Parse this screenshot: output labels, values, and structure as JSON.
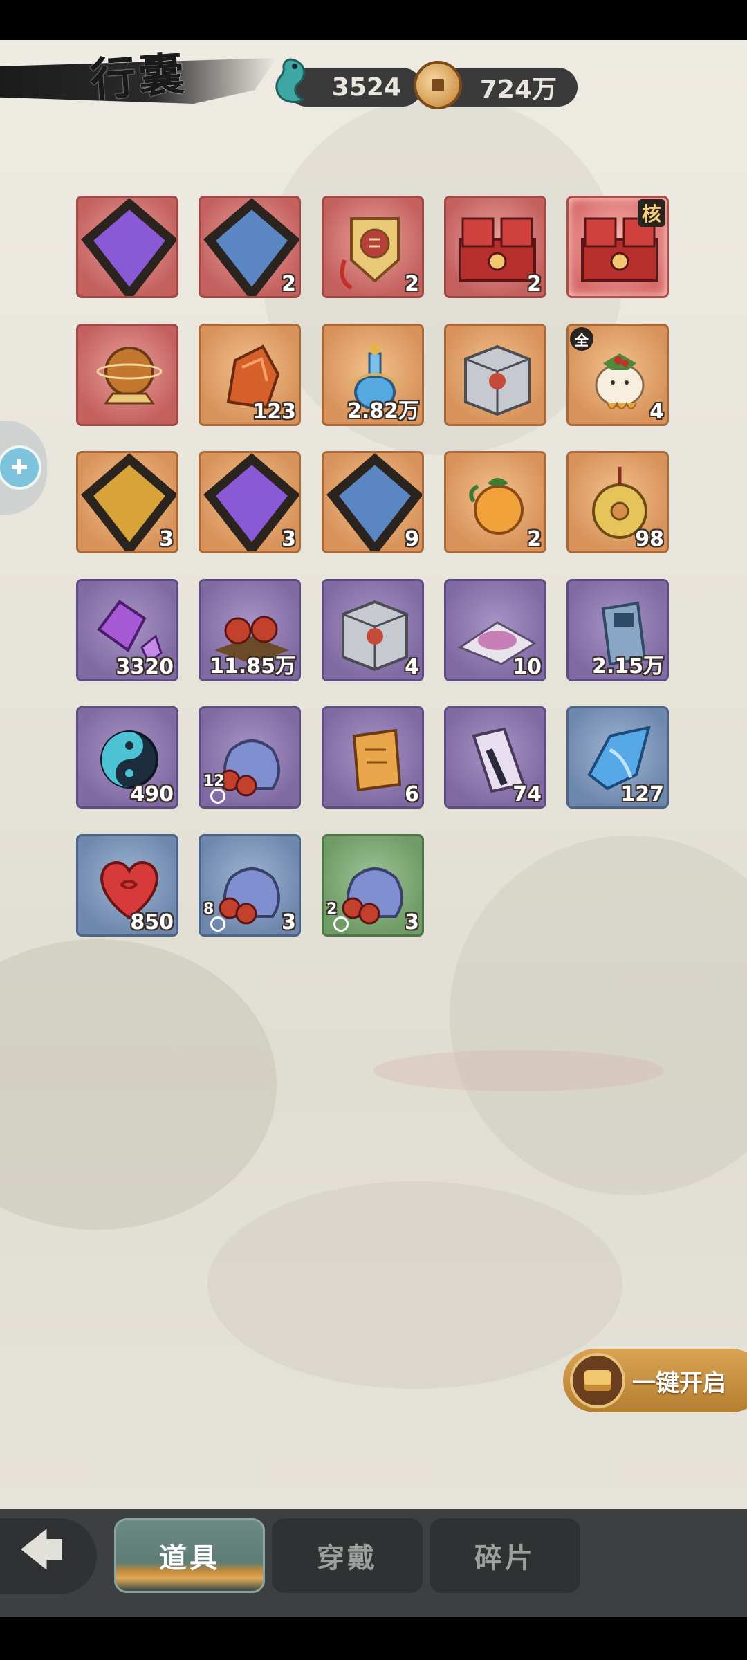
{
  "header": {
    "title": "行囊",
    "jade_count": "3524",
    "coin_count": "724万"
  },
  "items": [
    {
      "row": 0,
      "col": 0,
      "color": "red",
      "icon": "ginseng-doll-icon",
      "badge": "purple-gem",
      "count": ""
    },
    {
      "row": 0,
      "col": 1,
      "color": "red",
      "icon": "ginseng-doll-icon",
      "badge": "blue-gem",
      "count": "2"
    },
    {
      "row": 0,
      "col": 2,
      "color": "red",
      "icon": "token-plaque-icon",
      "badge": "",
      "count": "2"
    },
    {
      "row": 0,
      "col": 3,
      "color": "red",
      "icon": "treasure-chest-icon",
      "badge": "",
      "count": "2"
    },
    {
      "row": 0,
      "col": 4,
      "color": "red-hi",
      "icon": "treasure-chest-icon",
      "badge": "核",
      "count": ""
    },
    {
      "row": 1,
      "col": 0,
      "color": "red",
      "icon": "orb-on-stand-icon",
      "badge": "",
      "count": ""
    },
    {
      "row": 1,
      "col": 1,
      "color": "orange",
      "icon": "ore-crystal-icon",
      "badge": "",
      "count": "123"
    },
    {
      "row": 1,
      "col": 2,
      "color": "orange",
      "icon": "blue-flask-icon",
      "badge": "",
      "count": "2.82万"
    },
    {
      "row": 1,
      "col": 3,
      "color": "orange",
      "icon": "silver-box-icon",
      "badge": "",
      "count": ""
    },
    {
      "row": 1,
      "col": 4,
      "color": "orange",
      "icon": "ginseng-doll-icon",
      "badge": "全",
      "count": "4"
    },
    {
      "row": 2,
      "col": 0,
      "color": "orange",
      "icon": "ginseng-doll-icon",
      "badge": "gold-gem",
      "count": "3"
    },
    {
      "row": 2,
      "col": 1,
      "color": "orange",
      "icon": "ginseng-doll-icon",
      "badge": "purple-gem",
      "count": "3"
    },
    {
      "row": 2,
      "col": 2,
      "color": "orange",
      "icon": "ginseng-doll-icon",
      "badge": "blue-gem",
      "count": "9"
    },
    {
      "row": 2,
      "col": 3,
      "color": "orange",
      "icon": "orange-fruit-icon",
      "badge": "",
      "count": "2"
    },
    {
      "row": 2,
      "col": 4,
      "color": "orange",
      "icon": "jade-ring-icon",
      "badge": "",
      "count": "98"
    },
    {
      "row": 3,
      "col": 0,
      "color": "purple",
      "icon": "purple-crystal-icon",
      "badge": "",
      "count": "3320"
    },
    {
      "row": 3,
      "col": 1,
      "color": "purple",
      "icon": "red-beads-icon",
      "badge": "",
      "count": "11.85万"
    },
    {
      "row": 3,
      "col": 2,
      "color": "purple",
      "icon": "silver-box-icon",
      "badge": "",
      "count": "4"
    },
    {
      "row": 3,
      "col": 3,
      "color": "purple",
      "icon": "powder-pack-icon",
      "badge": "",
      "count": "10"
    },
    {
      "row": 3,
      "col": 4,
      "color": "purple",
      "icon": "blue-tablet-icon",
      "badge": "",
      "count": "2.15万"
    },
    {
      "row": 4,
      "col": 0,
      "color": "purple",
      "icon": "yin-yang-icon",
      "badge": "",
      "count": "490"
    },
    {
      "row": 4,
      "col": 1,
      "color": "purple",
      "icon": "lucky-bag-icon",
      "badge": "",
      "count": "",
      "sub": "12"
    },
    {
      "row": 4,
      "col": 2,
      "color": "purple",
      "icon": "scroll-icon",
      "badge": "",
      "count": "6"
    },
    {
      "row": 4,
      "col": 3,
      "color": "purple",
      "icon": "folded-paper-icon",
      "badge": "",
      "count": "74"
    },
    {
      "row": 4,
      "col": 4,
      "color": "blue",
      "icon": "ice-crystal-icon",
      "badge": "",
      "count": "127"
    },
    {
      "row": 5,
      "col": 0,
      "color": "blue",
      "icon": "heart-icon",
      "badge": "",
      "count": "850"
    },
    {
      "row": 5,
      "col": 1,
      "color": "blue",
      "icon": "lucky-bag-icon",
      "badge": "",
      "count": "3",
      "sub": "8"
    },
    {
      "row": 5,
      "col": 2,
      "color": "green",
      "icon": "lucky-bag-icon",
      "badge": "",
      "count": "3",
      "sub": "2"
    }
  ],
  "open_all": {
    "label": "一键开启"
  },
  "tabs": [
    {
      "label": "道具",
      "active": true
    },
    {
      "label": "穿戴",
      "active": false
    },
    {
      "label": "碎片",
      "active": false
    }
  ],
  "colors": {
    "red": "#c4615f",
    "orange": "#d8925a",
    "purple": "#7f6aa3",
    "blue": "#6e88ad",
    "green": "#6f9b66",
    "tab_active": "#5f7d76"
  }
}
